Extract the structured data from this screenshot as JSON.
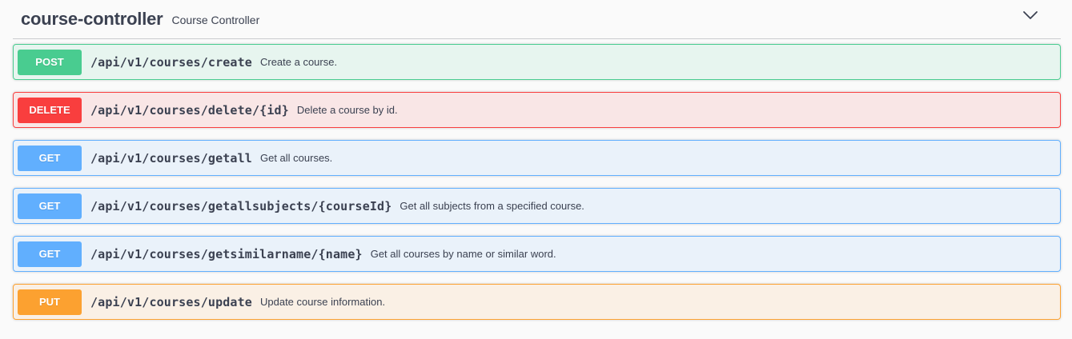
{
  "tag": {
    "name": "course-controller",
    "description": "Course Controller"
  },
  "operations": [
    {
      "method": "POST",
      "path": "/api/v1/courses/create",
      "summary": "Create a course."
    },
    {
      "method": "DELETE",
      "path": "/api/v1/courses/delete/{id}",
      "summary": "Delete a course by id."
    },
    {
      "method": "GET",
      "path": "/api/v1/courses/getall",
      "summary": "Get all courses."
    },
    {
      "method": "GET",
      "path": "/api/v1/courses/getallsubjects/{courseId}",
      "summary": "Get all subjects from a specified course."
    },
    {
      "method": "GET",
      "path": "/api/v1/courses/getsimilarname/{name}",
      "summary": "Get all courses by name or similar word."
    },
    {
      "method": "PUT",
      "path": "/api/v1/courses/update",
      "summary": "Update course information."
    }
  ],
  "colors": {
    "post": "#49cc90",
    "delete": "#f93e3e",
    "get": "#61affe",
    "put": "#fca130",
    "text": "#3b4151"
  },
  "icons": {
    "collapse": "chevron-down-icon"
  }
}
